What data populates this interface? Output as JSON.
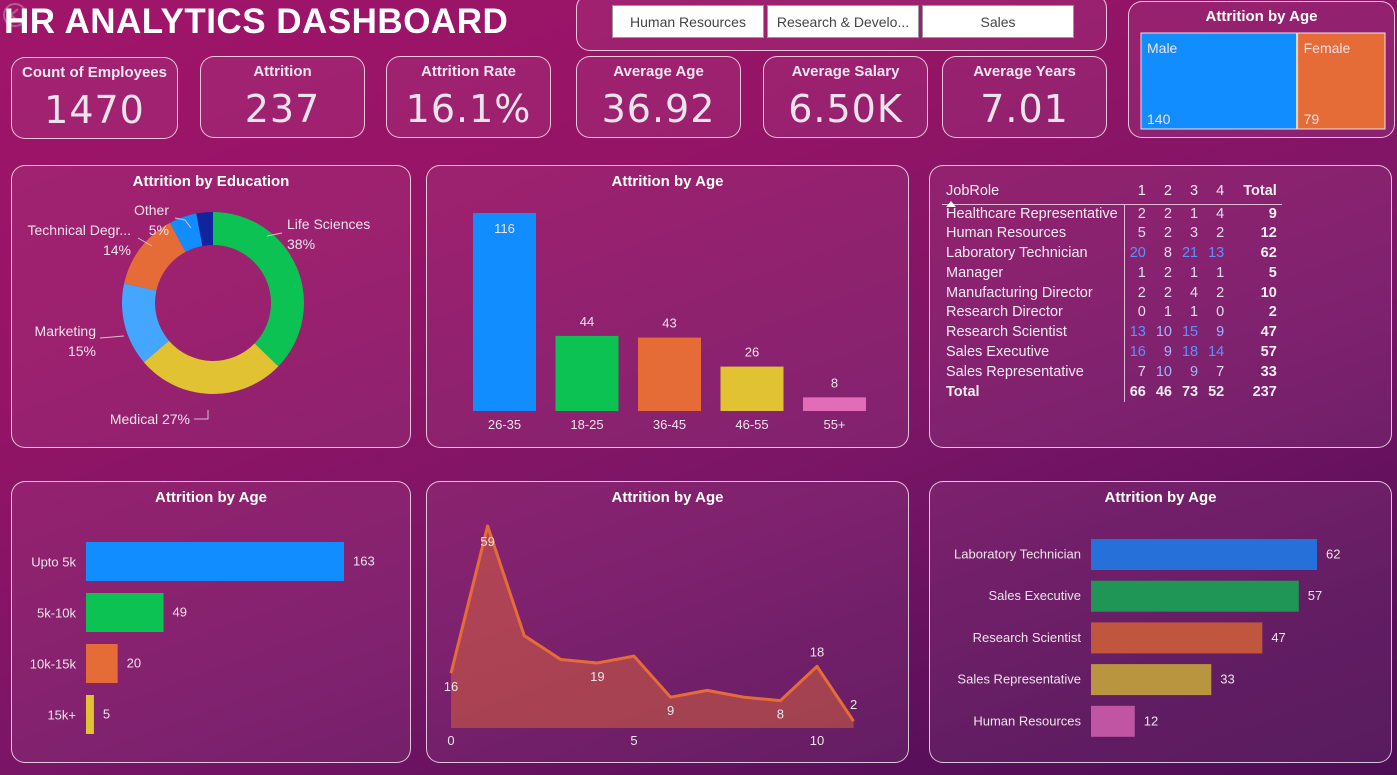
{
  "header": {
    "title": "HR ANALYTICS DASHBOARD",
    "back_icon": "back-arrow-icon"
  },
  "slicer": {
    "options": [
      "Human Resources",
      "Research & Develo...",
      "Sales"
    ]
  },
  "kpis": [
    {
      "label": "Count of Employees",
      "value": "1470"
    },
    {
      "label": "Attrition",
      "value": "237"
    },
    {
      "label": "Attrition Rate",
      "value": "16.1%"
    },
    {
      "label": "Average Age",
      "value": "36.92"
    },
    {
      "label": "Average Salary",
      "value": "6.50K"
    },
    {
      "label": "Average Years",
      "value": "7.01"
    }
  ],
  "colors": {
    "blue": "#118dff",
    "green": "#0bc252",
    "orange": "#e66c37",
    "yellow": "#e0c232",
    "pink": "#e26cb8",
    "navy": "#12239e",
    "lightblue": "#44a6fe",
    "matrix_highlight": "#4d8ff0"
  },
  "chart_data": [
    {
      "id": "gender_treemap",
      "type": "treemap",
      "title": "Attrition by Age",
      "categories": [
        "Male",
        "Female"
      ],
      "values": [
        140,
        79
      ],
      "colors": [
        "#118dff",
        "#e66c37"
      ]
    },
    {
      "id": "education_donut",
      "type": "pie",
      "title": "Attrition by Education",
      "categories": [
        "Life Sciences",
        "Medical",
        "Marketing",
        "Technical Degr...",
        "Other",
        "(unlabeled)"
      ],
      "values": [
        38,
        27,
        15,
        14,
        5,
        3
      ],
      "labels": [
        "Life Sciences\n38%",
        "Medical 27%",
        "Marketing\n15%",
        "Technical Degr...\n14%",
        "Other\n5%",
        ""
      ],
      "colors": [
        "#0bc252",
        "#e0c232",
        "#44a6fe",
        "#e66c37",
        "#118dff",
        "#12239e"
      ],
      "unit": "%"
    },
    {
      "id": "age_column",
      "type": "bar",
      "title": "Attrition by Age",
      "categories": [
        "26-35",
        "18-25",
        "36-45",
        "46-55",
        "55+"
      ],
      "values": [
        116,
        44,
        43,
        26,
        8
      ],
      "colors": [
        "#118dff",
        "#0bc252",
        "#e66c37",
        "#e0c232",
        "#e26cb8"
      ],
      "ylim": [
        0,
        116
      ]
    },
    {
      "id": "jobrole_matrix",
      "type": "table",
      "columns": [
        "JobRole",
        "1",
        "2",
        "3",
        "4",
        "Total"
      ],
      "rows": [
        {
          "role": "Healthcare Representative",
          "values": [
            2,
            2,
            1,
            4
          ],
          "total": 9
        },
        {
          "role": "Human Resources",
          "values": [
            5,
            2,
            3,
            2
          ],
          "total": 12
        },
        {
          "role": "Laboratory Technician",
          "values": [
            20,
            8,
            21,
            13
          ],
          "total": 62
        },
        {
          "role": "Manager",
          "values": [
            1,
            2,
            1,
            1
          ],
          "total": 5
        },
        {
          "role": "Manufacturing Director",
          "values": [
            2,
            2,
            4,
            2
          ],
          "total": 10
        },
        {
          "role": "Research Director",
          "values": [
            0,
            1,
            1,
            0
          ],
          "total": 2
        },
        {
          "role": "Research Scientist",
          "values": [
            13,
            10,
            15,
            9
          ],
          "total": 47
        },
        {
          "role": "Sales Executive",
          "values": [
            16,
            9,
            18,
            14
          ],
          "total": 57
        },
        {
          "role": "Sales Representative",
          "values": [
            7,
            10,
            9,
            7
          ],
          "total": 33
        }
      ],
      "total_row": {
        "label": "Total",
        "values": [
          66,
          46,
          73,
          52
        ],
        "total": 237
      }
    },
    {
      "id": "salary_bar",
      "type": "bar",
      "orientation": "horizontal",
      "title": "Attrition by Age",
      "categories": [
        "Upto 5k",
        "5k-10k",
        "10k-15k",
        "15k+"
      ],
      "values": [
        163,
        49,
        20,
        5
      ],
      "colors": [
        "#118dff",
        "#0bc252",
        "#e66c37",
        "#e0c232"
      ],
      "xlim": [
        0,
        163
      ]
    },
    {
      "id": "years_area",
      "type": "area",
      "title": "Attrition by Age",
      "x": [
        0,
        1,
        2,
        3,
        4,
        5,
        6,
        7,
        8,
        9,
        10,
        11
      ],
      "values": [
        16,
        59,
        27,
        20,
        19,
        21,
        9,
        11,
        9,
        8,
        18,
        2
      ],
      "labeled_indices": [
        0,
        1,
        4,
        6,
        9,
        10,
        11
      ],
      "xticks": [
        0,
        5,
        10
      ],
      "ylim": [
        0,
        59
      ],
      "color": "#e66c37"
    },
    {
      "id": "jobrole_bar",
      "type": "bar",
      "orientation": "horizontal",
      "title": "Attrition by Age",
      "categories": [
        "Laboratory Technician",
        "Sales Executive",
        "Research Scientist",
        "Sales Representative",
        "Human Resources"
      ],
      "values": [
        62,
        57,
        47,
        33,
        12
      ],
      "colors": [
        "#2671d9",
        "#1f9556",
        "#c1563f",
        "#b9953f",
        "#c055a3"
      ],
      "xlim": [
        0,
        62
      ]
    }
  ]
}
